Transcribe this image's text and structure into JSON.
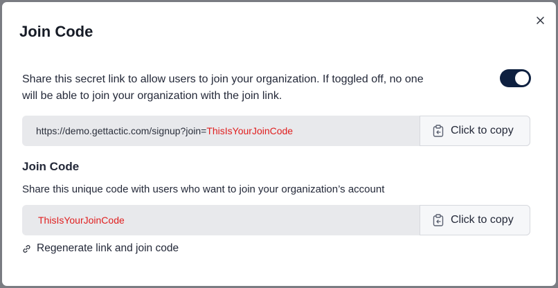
{
  "modal": {
    "title": "Join Code",
    "close_icon": "close-icon"
  },
  "join_link": {
    "description": "Share this secret link to allow users to join your organization. If toggled off, no one will be able to join your organization with the join link.",
    "toggle_on": true,
    "url_prefix": "https://demo.gettactic.com/signup?join=",
    "url_code": "ThisIsYourJoinCode",
    "copy_label": "Click to copy",
    "copy_icon": "clipboard-icon"
  },
  "join_code": {
    "heading": "Join Code",
    "description": "Share this unique code with users who want to join your organization’s account",
    "code": "ThisIsYourJoinCode",
    "copy_label": "Click to copy",
    "copy_icon": "clipboard-icon"
  },
  "regenerate": {
    "label": "Regenerate link and join code",
    "icon": "link-icon"
  },
  "colors": {
    "toggle_bg": "#0e2040",
    "code_text": "#e01e1e",
    "field_bg": "#e8e9ec"
  }
}
